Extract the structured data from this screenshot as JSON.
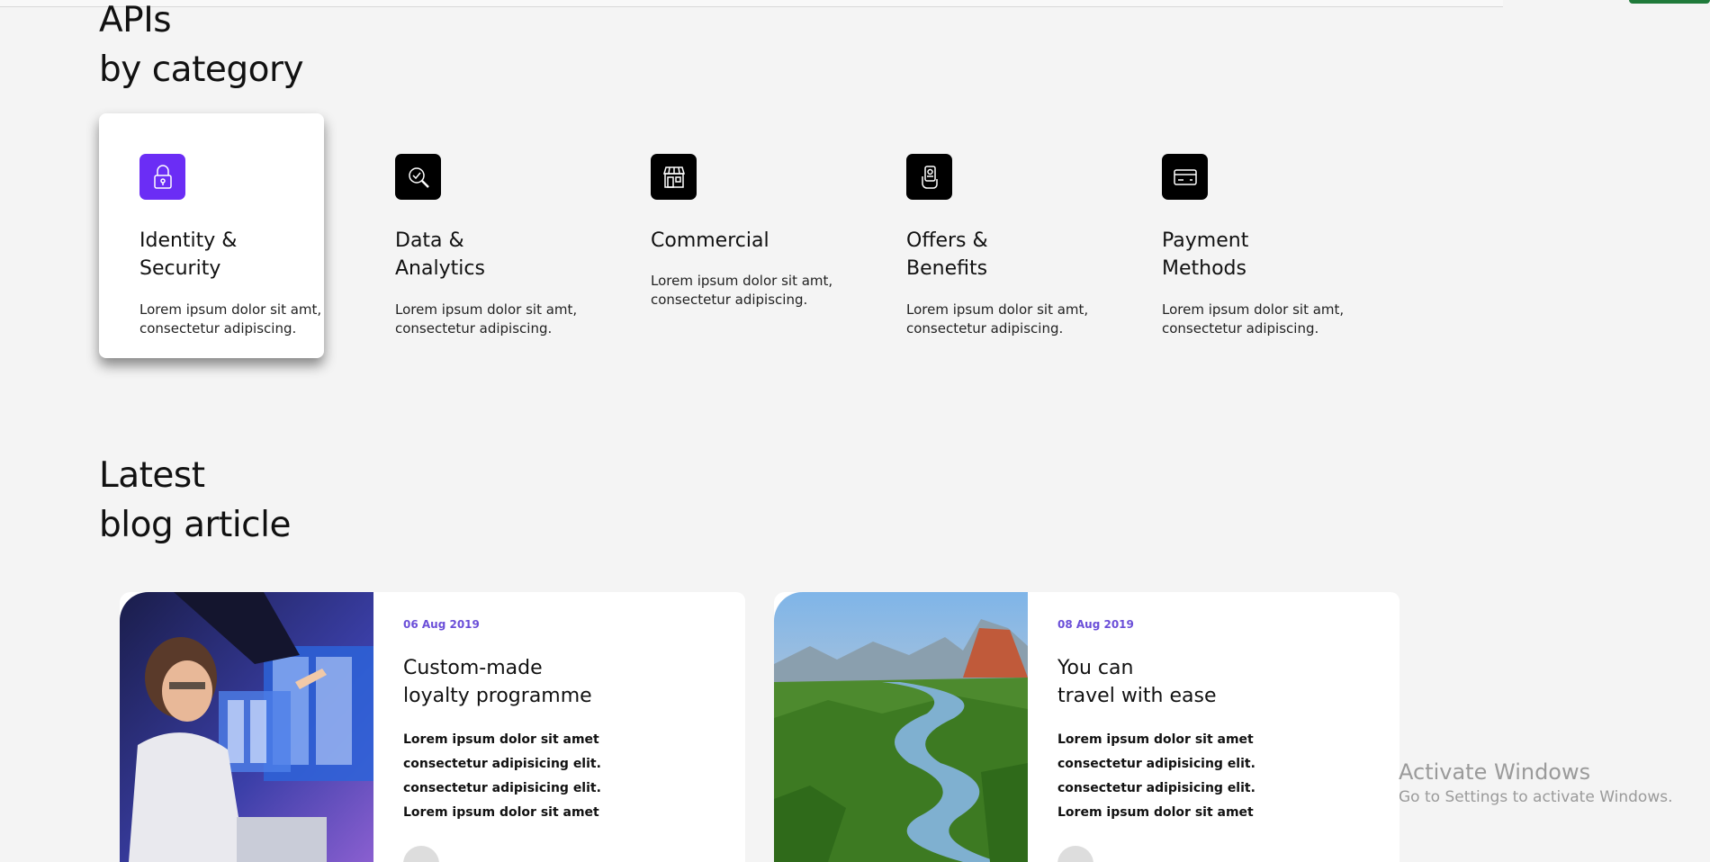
{
  "apis_section": {
    "title_line1": "APIs",
    "title_line2": "by category"
  },
  "categories": [
    {
      "title_line1": "Identity &",
      "title_line2": "Security",
      "desc_line1": "Lorem ipsum dolor sit amt,",
      "desc_line2": "consectetur adipiscing.",
      "icon": "lock-icon",
      "active": true
    },
    {
      "title_line1": "Data &",
      "title_line2": "Analytics",
      "desc_line1": "Lorem ipsum dolor sit amt,",
      "desc_line2": "consectetur adipiscing.",
      "icon": "analytics-search-icon",
      "active": false
    },
    {
      "title_line1": "Commercial",
      "title_line2": "",
      "desc_line1": "Lorem ipsum dolor sit amt,",
      "desc_line2": "consectetur adipiscing.",
      "icon": "storefront-icon",
      "active": false
    },
    {
      "title_line1": "Offers &",
      "title_line2": "Benefits",
      "desc_line1": "Lorem ipsum dolor sit amt,",
      "desc_line2": "consectetur adipiscing.",
      "icon": "offers-hand-icon",
      "active": false
    },
    {
      "title_line1": "Payment",
      "title_line2": "Methods",
      "desc_line1": "Lorem ipsum dolor sit amt,",
      "desc_line2": "consectetur adipiscing.",
      "icon": "credit-card-icon",
      "active": false
    }
  ],
  "blog_section": {
    "title_line1": "Latest",
    "title_line2": "blog article"
  },
  "articles": [
    {
      "date": "06 Aug 2019",
      "title_line1": "Custom-made",
      "title_line2": "loyalty programme",
      "text": [
        "Lorem ipsum dolor sit amet",
        "consectetur adipisicing elit.",
        "consectetur adipisicing elit.",
        "Lorem ipsum dolor sit amet"
      ]
    },
    {
      "date": "08 Aug 2019",
      "title_line1": "You can",
      "title_line2": "travel with ease",
      "text": [
        "Lorem ipsum dolor sit amet",
        "consectetur adipisicing elit.",
        "consectetur adipisicing elit.",
        "Lorem ipsum dolor sit amet"
      ]
    }
  ],
  "watermark": {
    "title": "Activate Windows",
    "subtitle": "Go to Settings to activate Windows."
  },
  "colors": {
    "accent": "#6b2df5",
    "date": "#6b4fd8",
    "background": "#f4f4f4"
  }
}
